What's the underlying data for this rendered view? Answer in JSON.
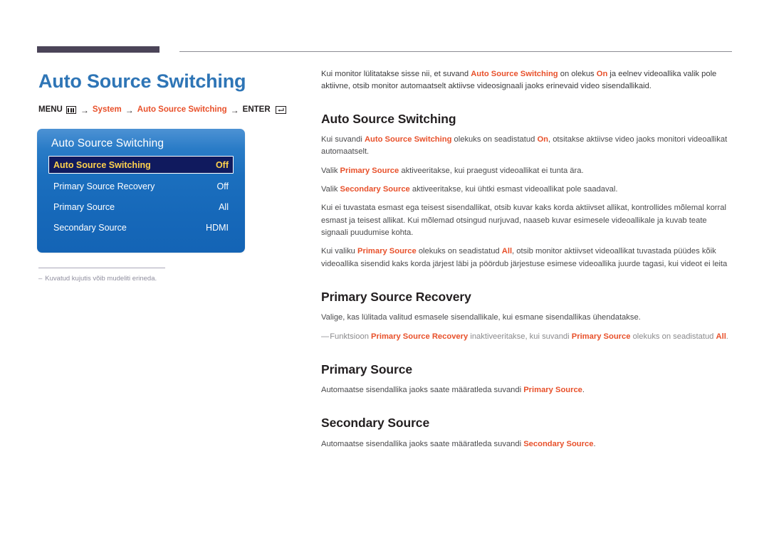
{
  "document": {
    "page_title": "Auto Source Switching",
    "breadcrumb": {
      "menu_label": "MENU",
      "menu_icon": "menu-grid-icon",
      "arrow": "→",
      "step_system": "System",
      "step_auto_source_switching": "Auto Source Switching",
      "enter_label": "ENTER",
      "enter_icon": "enter-return-icon"
    },
    "colors": {
      "title_blue": "#2e75b6",
      "accent_orange": "#e8502a",
      "rule_purple": "#4b4458",
      "osd_blue": "#1668b9",
      "osd_selected_navy": "#101a5e",
      "osd_selected_yellow": "#ffd24d",
      "body_gray": "#4a4a4c",
      "note_gray": "#8a8a8c"
    }
  },
  "osd_menu": {
    "title": "Auto Source Switching",
    "rows": [
      {
        "label": "Auto Source Switching",
        "value": "Off",
        "selected": true
      },
      {
        "label": "Primary Source Recovery",
        "value": "Off",
        "selected": false
      },
      {
        "label": "Primary Source",
        "value": "All",
        "selected": false
      },
      {
        "label": "Secondary Source",
        "value": "HDMI",
        "selected": false
      }
    ]
  },
  "left_note": {
    "dash": "–",
    "text": "Kuvatud kujutis võib mudeliti erineda."
  },
  "content": {
    "intro": {
      "part1": "Kui monitor lülitatakse sisse nii, et suvand ",
      "hl1": "Auto Source Switching",
      "part2": " on olekus ",
      "hl2": "On",
      "part3": " ja eelnev videoallika valik pole aktiivne, otsib monitor automaatselt aktiivse videosignaali jaoks erinevaid video sisendallikaid."
    },
    "sections": [
      {
        "heading": "Auto Source Switching",
        "paragraphs": [
          {
            "part1": "Kui suvandi ",
            "hl1": "Auto Source Switching",
            "part2": " olekuks on seadistatud ",
            "hl2": "On",
            "part3": ", otsitakse aktiivse video jaoks monitori videoallikat automaatselt."
          },
          {
            "part1": "Valik ",
            "hl1": "Primary Source",
            "part2": " aktiveeritakse, kui praegust videoallikat ei tunta ära.",
            "hl2": "",
            "part3": ""
          },
          {
            "part1": "Valik ",
            "hl1": "Secondary Source",
            "part2": " aktiveeritakse, kui ühtki esmast videoallikat pole saadaval.",
            "hl2": "",
            "part3": ""
          },
          {
            "part1": "Kui ei tuvastata esmast ega teisest sisendallikat, otsib kuvar kaks korda aktiivset allikat, kontrollides mõlemal korral esmast ja teisest allikat. Kui mõlemad otsingud nurjuvad, naaseb kuvar esimesele videoallikale ja kuvab teate signaali puudumise kohta.",
            "hl1": "",
            "part2": "",
            "hl2": "",
            "part3": ""
          },
          {
            "part1": "Kui valiku ",
            "hl1": "Primary Source",
            "part2": " olekuks on seadistatud ",
            "hl2": "All",
            "part3": ", otsib monitor aktiivset videoallikat tuvastada püüdes kõik videoallika sisendid kaks korda järjest läbi ja pöördub järjestuse esimese videoallika juurde tagasi, kui videot ei leita"
          }
        ]
      }
    ],
    "primary_source_recovery": {
      "heading": "Primary Source Recovery",
      "paragraph": "Valige, kas lülitada valitud esmasele sisendallikale, kui esmane sisendallikas ühendatakse.",
      "note": {
        "emdash": "—",
        "part1": "Funktsioon ",
        "hl1": "Primary Source Recovery",
        "part2": " inaktiveeritakse, kui suvandi ",
        "hl2": "Primary Source",
        "part3": " olekuks on seadistatud ",
        "hl3": "All",
        "part4": "."
      }
    },
    "primary_source": {
      "heading": "Primary Source",
      "part1": "Automaatse sisendallika jaoks saate määratleda suvandi ",
      "hl1": "Primary Source",
      "part2": "."
    },
    "secondary_source": {
      "heading": "Secondary Source",
      "part1": "Automaatse sisendallika jaoks saate määratleda suvandi ",
      "hl1": "Secondary Source",
      "part2": "."
    }
  }
}
